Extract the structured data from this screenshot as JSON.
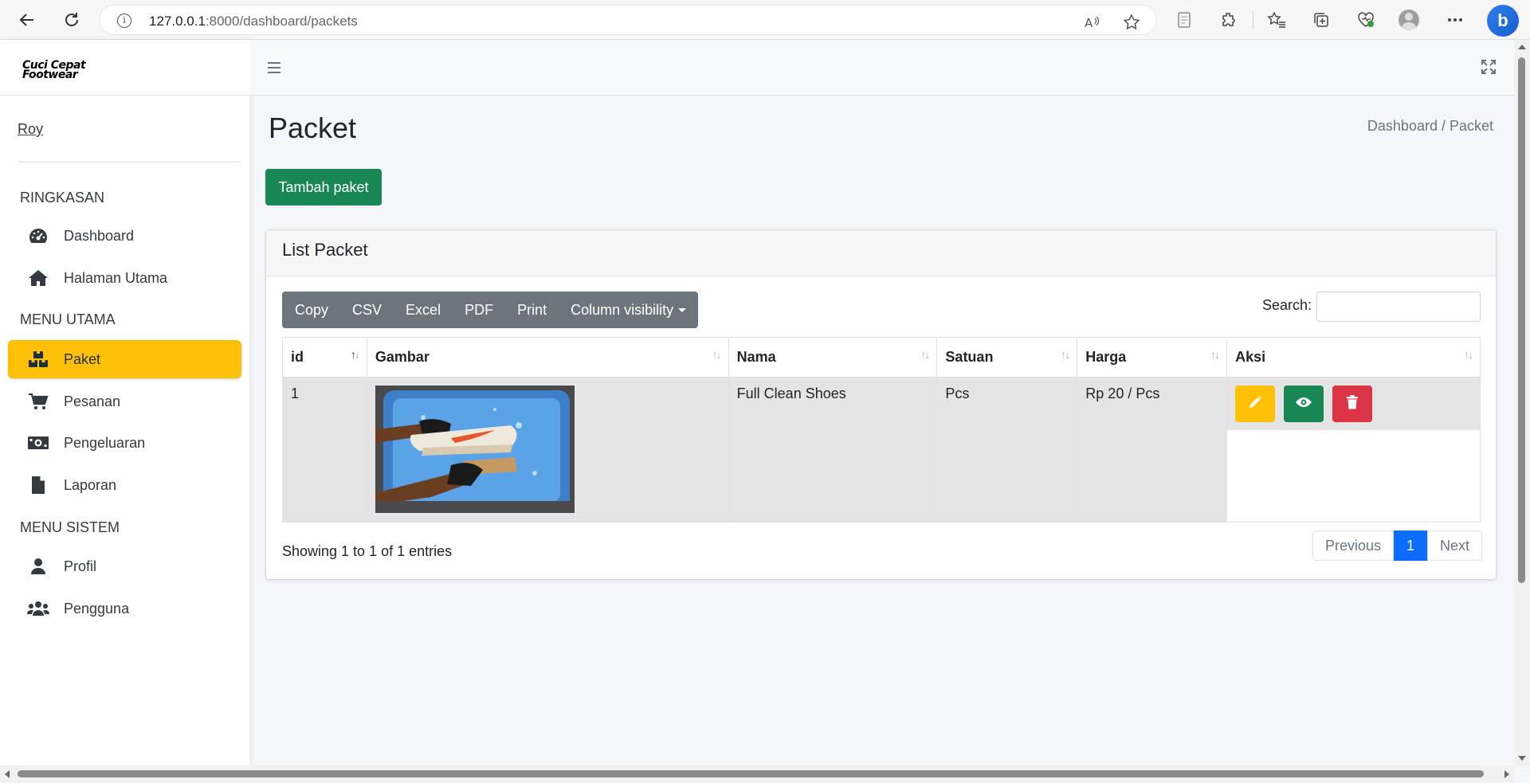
{
  "browser": {
    "url_host": "127.0.0.1",
    "url_path": ":8000/dashboard/packets"
  },
  "sidebar": {
    "brand_line1": "Cuci Cepat",
    "brand_line2": "Footwear",
    "user_name": "Roy",
    "sections": [
      {
        "header": "RINGKASAN"
      },
      {
        "header": "MENU UTAMA"
      },
      {
        "header": "MENU SISTEM"
      }
    ],
    "items": [
      {
        "label": "Dashboard",
        "icon": "gauge-icon"
      },
      {
        "label": "Halaman Utama",
        "icon": "home-icon"
      },
      {
        "label": "Paket",
        "icon": "boxes-icon",
        "active": true
      },
      {
        "label": "Pesanan",
        "icon": "cart-icon"
      },
      {
        "label": "Pengeluaran",
        "icon": "money-icon"
      },
      {
        "label": "Laporan",
        "icon": "file-icon"
      },
      {
        "label": "Profil",
        "icon": "user-icon"
      },
      {
        "label": "Pengguna",
        "icon": "users-icon"
      }
    ]
  },
  "page": {
    "title": "Packet",
    "breadcrumb": "Dashboard / Packet",
    "add_button": "Tambah paket"
  },
  "card": {
    "title": "List Packet",
    "buttons": [
      "Copy",
      "CSV",
      "Excel",
      "PDF",
      "Print",
      "Column visibility"
    ],
    "search_label": "Search:",
    "search_value": "",
    "columns": [
      "id",
      "Gambar",
      "Nama",
      "Satuan",
      "Harga",
      "Aksi"
    ],
    "rows": [
      {
        "id": "1",
        "nama": "Full Clean Shoes",
        "satuan": "Pcs",
        "harga": "Rp 20 / Pcs"
      }
    ],
    "info": "Showing 1 to 1 of 1 entries",
    "pagination": {
      "previous": "Previous",
      "current": "1",
      "next": "Next"
    }
  },
  "colors": {
    "active": "#ffc107",
    "success": "#198754",
    "danger": "#dc3545",
    "primary": "#0d6efd"
  }
}
